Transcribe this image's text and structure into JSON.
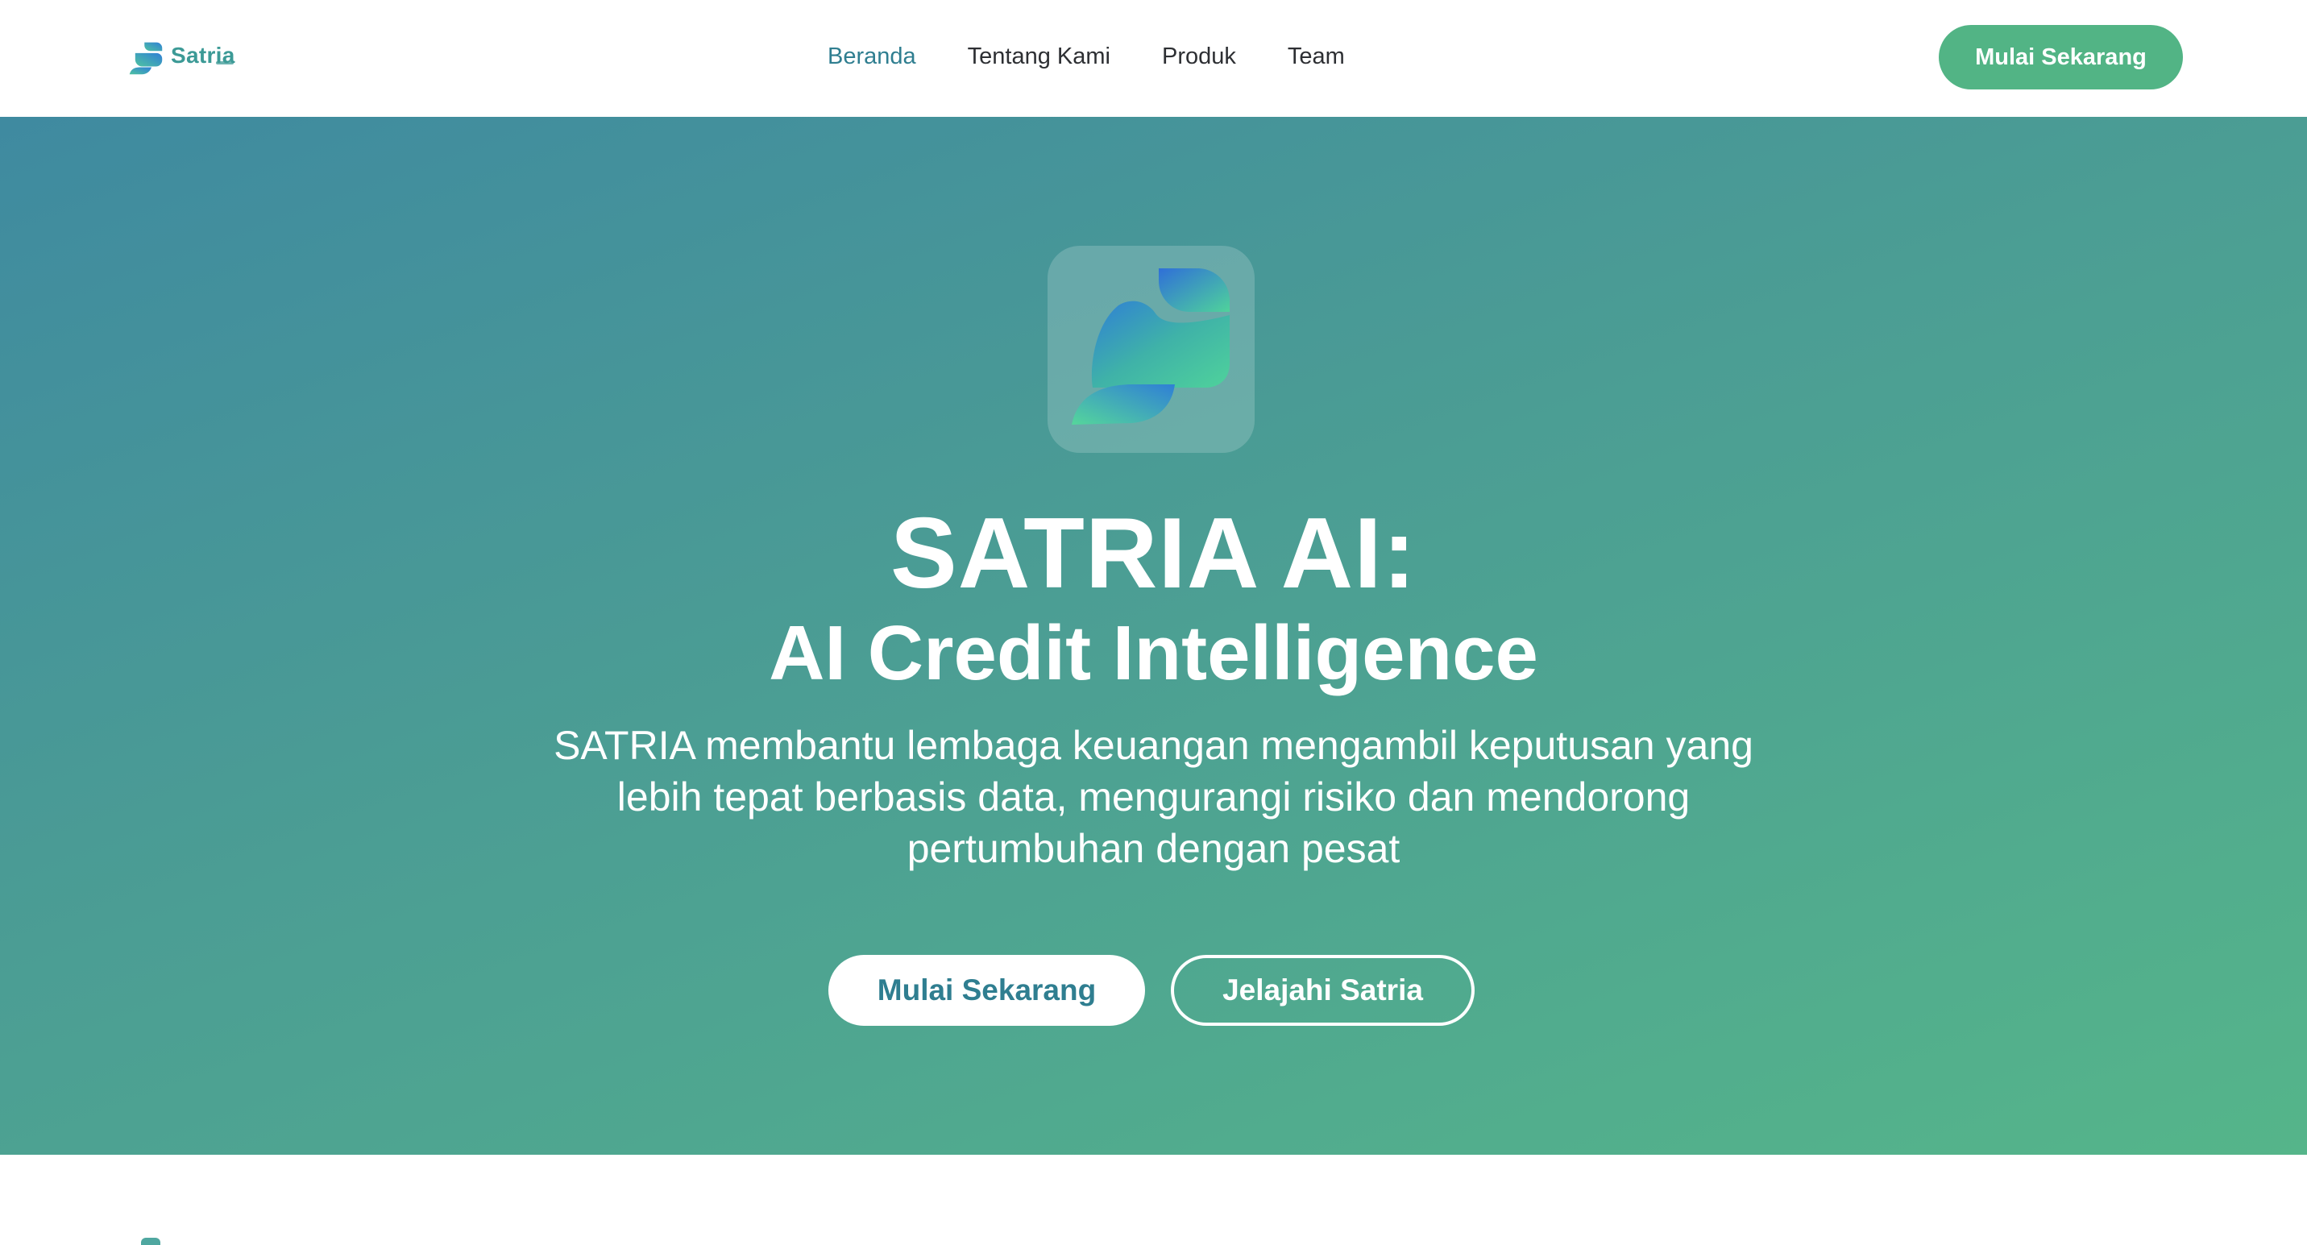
{
  "navbar": {
    "brand": {
      "name": "Satria",
      "icon": "satria-logo-icon"
    },
    "links": [
      {
        "label": "Beranda",
        "active": true
      },
      {
        "label": "Tentang Kami",
        "active": false
      },
      {
        "label": "Produk",
        "active": false
      },
      {
        "label": "Team",
        "active": false
      }
    ],
    "cta_label": "Mulai Sekarang"
  },
  "hero": {
    "logo_icon": "satria-logo-icon",
    "title": "SATRIA AI:",
    "subtitle": "AI Credit Intelligence",
    "description": "SATRIA membantu lembaga keuangan mengambil keputusan yang lebih tepat berbasis data, mengurangi risiko dan mendorong pertumbuhan dengan pesat",
    "primary_button": "Mulai Sekarang",
    "secondary_button": "Jelajahi Satria"
  },
  "colors": {
    "accent": "#52b485",
    "nav_active": "#2f7e90",
    "hero_gradient_start": "#3f8aa0",
    "hero_gradient_end": "#55b58a",
    "text_dark": "#2d2f33",
    "white": "#ffffff"
  }
}
